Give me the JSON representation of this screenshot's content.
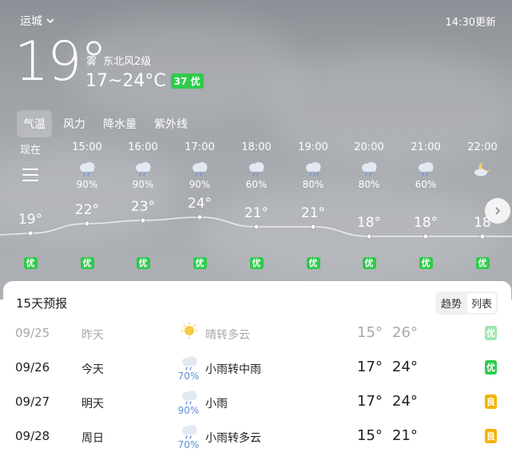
{
  "header": {
    "city": "运城",
    "update_time": "14:30更新"
  },
  "current": {
    "temp": "19°",
    "condition": "雾",
    "wind": "东北风2级",
    "range": "17~24°C",
    "aqi": "37 优",
    "aqi_color": "#2ecb4b"
  },
  "tabs": [
    "气温",
    "风力",
    "降水量",
    "紫外线"
  ],
  "active_tab": 0,
  "hourly": [
    {
      "time": "现在",
      "icon": "menu-icon",
      "pct": "",
      "temp": "19°",
      "aqi": "优"
    },
    {
      "time": "15:00",
      "icon": "cloud-rain-icon",
      "pct": "90%",
      "temp": "22°",
      "aqi": "优"
    },
    {
      "time": "16:00",
      "icon": "cloud-rain-icon",
      "pct": "90%",
      "temp": "23°",
      "aqi": "优"
    },
    {
      "time": "17:00",
      "icon": "cloud-rain-icon",
      "pct": "90%",
      "temp": "24°",
      "aqi": "优"
    },
    {
      "time": "18:00",
      "icon": "cloud-rain-icon",
      "pct": "60%",
      "temp": "21°",
      "aqi": "优"
    },
    {
      "time": "19:00",
      "icon": "cloud-heavy-rain-icon",
      "pct": "80%",
      "temp": "21°",
      "aqi": "优"
    },
    {
      "time": "20:00",
      "icon": "cloud-rain-icon",
      "pct": "80%",
      "temp": "18°",
      "aqi": "优"
    },
    {
      "time": "21:00",
      "icon": "cloud-rain-icon",
      "pct": "60%",
      "temp": "18°",
      "aqi": "优"
    },
    {
      "time": "22:00",
      "icon": "moon-cloud-icon",
      "pct": "",
      "temp": "18",
      "aqi": "优"
    }
  ],
  "forecast": {
    "title": "15天预报",
    "toggle": [
      "趋势",
      "列表"
    ],
    "toggle_active": 1,
    "days": [
      {
        "date": "09/25",
        "name": "昨天",
        "icon": "sun-cloud-icon",
        "pct": "",
        "cond": "晴转多云",
        "lo": "15°",
        "hi": "26°",
        "aqi": "优",
        "aqi_color": "#2ecb4b",
        "past": true
      },
      {
        "date": "09/26",
        "name": "今天",
        "icon": "cloud-rain-icon",
        "pct": "70%",
        "cond": "小雨转中雨",
        "lo": "17°",
        "hi": "24°",
        "aqi": "优",
        "aqi_color": "#2ecb4b",
        "past": false
      },
      {
        "date": "09/27",
        "name": "明天",
        "icon": "cloud-rain-icon",
        "pct": "90%",
        "cond": "小雨",
        "lo": "17°",
        "hi": "24°",
        "aqi": "良",
        "aqi_color": "#f0b400",
        "past": false
      },
      {
        "date": "09/28",
        "name": "周日",
        "icon": "cloud-rain-icon",
        "pct": "70%",
        "cond": "小雨转多云",
        "lo": "15°",
        "hi": "21°",
        "aqi": "良",
        "aqi_color": "#f0b400",
        "past": false
      }
    ]
  }
}
